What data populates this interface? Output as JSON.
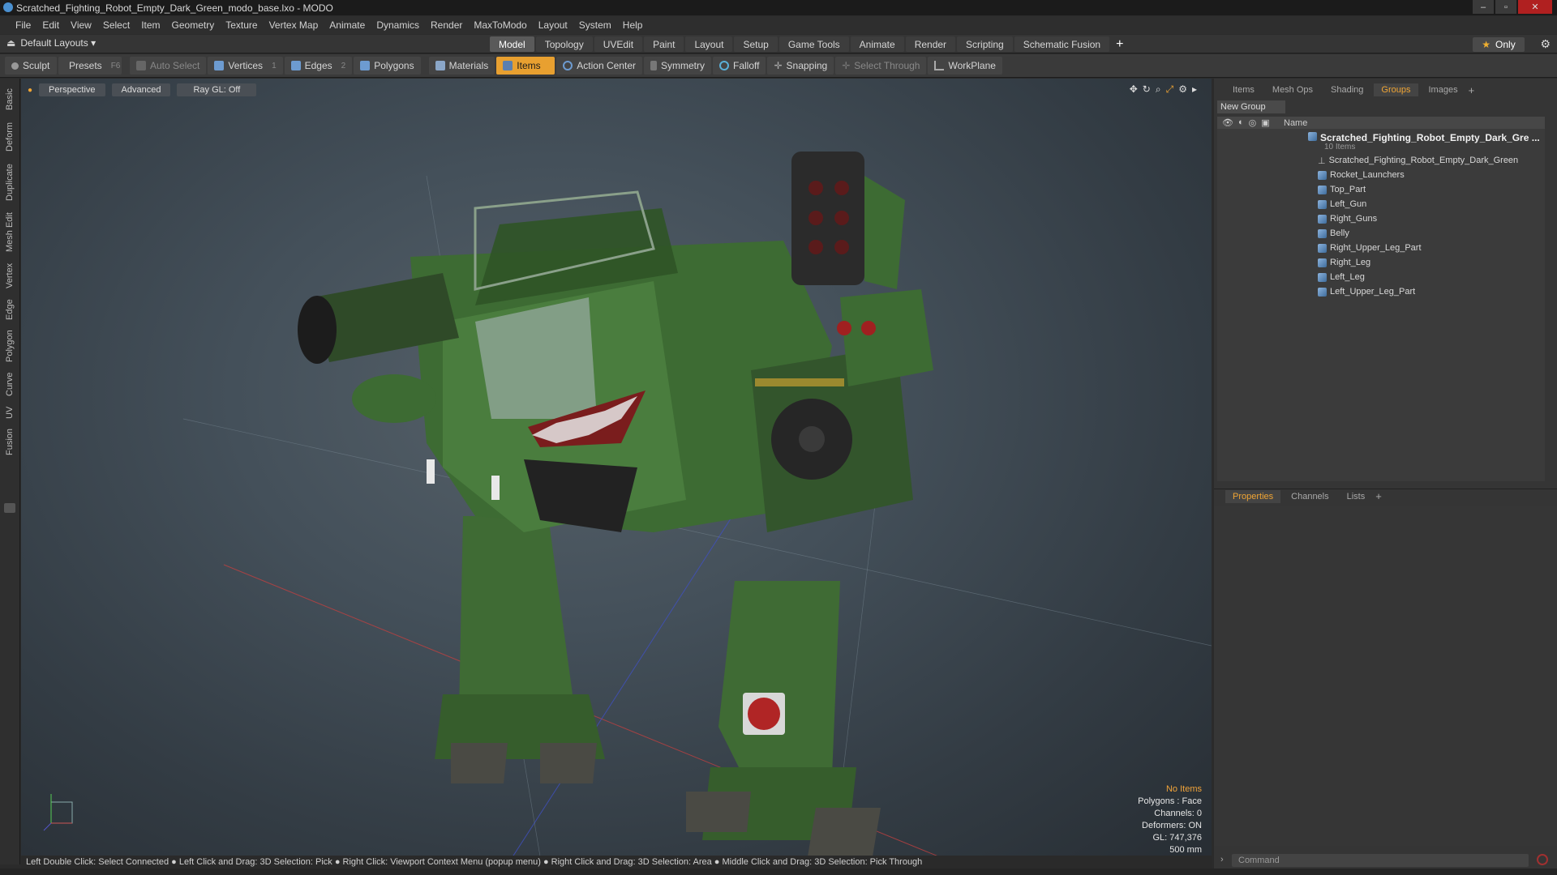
{
  "window": {
    "title": "Scratched_Fighting_Robot_Empty_Dark_Green_modo_base.lxo - MODO",
    "buttons": [
      "–",
      "▫",
      "✕"
    ]
  },
  "menu": [
    "File",
    "Edit",
    "View",
    "Select",
    "Item",
    "Geometry",
    "Texture",
    "Vertex Map",
    "Animate",
    "Dynamics",
    "Render",
    "MaxToModo",
    "Layout",
    "System",
    "Help"
  ],
  "layoutbar": {
    "layout_select": "Default Layouts ▾",
    "tabs": [
      "Model",
      "Topology",
      "UVEdit",
      "Paint",
      "Layout",
      "Setup",
      "Game Tools",
      "Animate",
      "Render",
      "Scripting",
      "Schematic Fusion"
    ],
    "active_tab": "Model",
    "plus": "+",
    "only_label": "Only"
  },
  "toolbar": {
    "sculpt": "Sculpt",
    "presets": "Presets",
    "presets_key": "F6",
    "auto_select": "Auto Select",
    "vertices": "Vertices",
    "vertices_count": "1",
    "edges": "Edges",
    "edges_count": "2",
    "polygons": "Polygons",
    "materials": "Materials",
    "items": "Items",
    "action_center": "Action Center",
    "symmetry": "Symmetry",
    "falloff": "Falloff",
    "snapping": "Snapping",
    "select_through": "Select Through",
    "workplane": "WorkPlane"
  },
  "left_tabs": [
    "Basic",
    "Deform",
    "Duplicate",
    "Mesh Edit",
    "Vertex",
    "Edge",
    "Polygon",
    "Curve",
    "UV",
    "Fusion"
  ],
  "viewport": {
    "view_mode": "Perspective",
    "shading": "Advanced",
    "raygl": "Ray GL: Off",
    "stats": {
      "selection": "No Items",
      "polygons": "Polygons : Face",
      "channels": "Channels: 0",
      "deformers": "Deformers: ON",
      "gl": "GL: 747,376",
      "scale": "500 mm"
    }
  },
  "statusbar": "Left Double Click: Select Connected ● Left Click and Drag: 3D Selection: Pick ● Right Click: Viewport Context Menu (popup menu) ● Right Click and Drag: 3D Selection: Area ● Middle Click and Drag: 3D Selection: Pick Through",
  "right_panel": {
    "tabs": [
      "Items",
      "Mesh Ops",
      "Shading",
      "Groups",
      "Images"
    ],
    "active_tab": "Groups",
    "plus": "+",
    "new_group": "New Group",
    "column_name": "Name",
    "root": {
      "name": "Scratched_Fighting_Robot_Empty_Dark_Gre ...",
      "count": "10 Items"
    },
    "items": [
      "Scratched_Fighting_Robot_Empty_Dark_Green",
      "Rocket_Launchers",
      "Top_Part",
      "Left_Gun",
      "Right_Guns",
      "Belly",
      "Right_Upper_Leg_Part",
      "Right_Leg",
      "Left_Leg",
      "Left_Upper_Leg_Part"
    ],
    "prop_tabs": [
      "Properties",
      "Channels",
      "Lists"
    ],
    "active_prop_tab": "Properties",
    "command_placeholder": "Command"
  },
  "colors": {
    "accent": "#f0a534",
    "active_tool": "#e8a030",
    "close": "#b02020"
  }
}
